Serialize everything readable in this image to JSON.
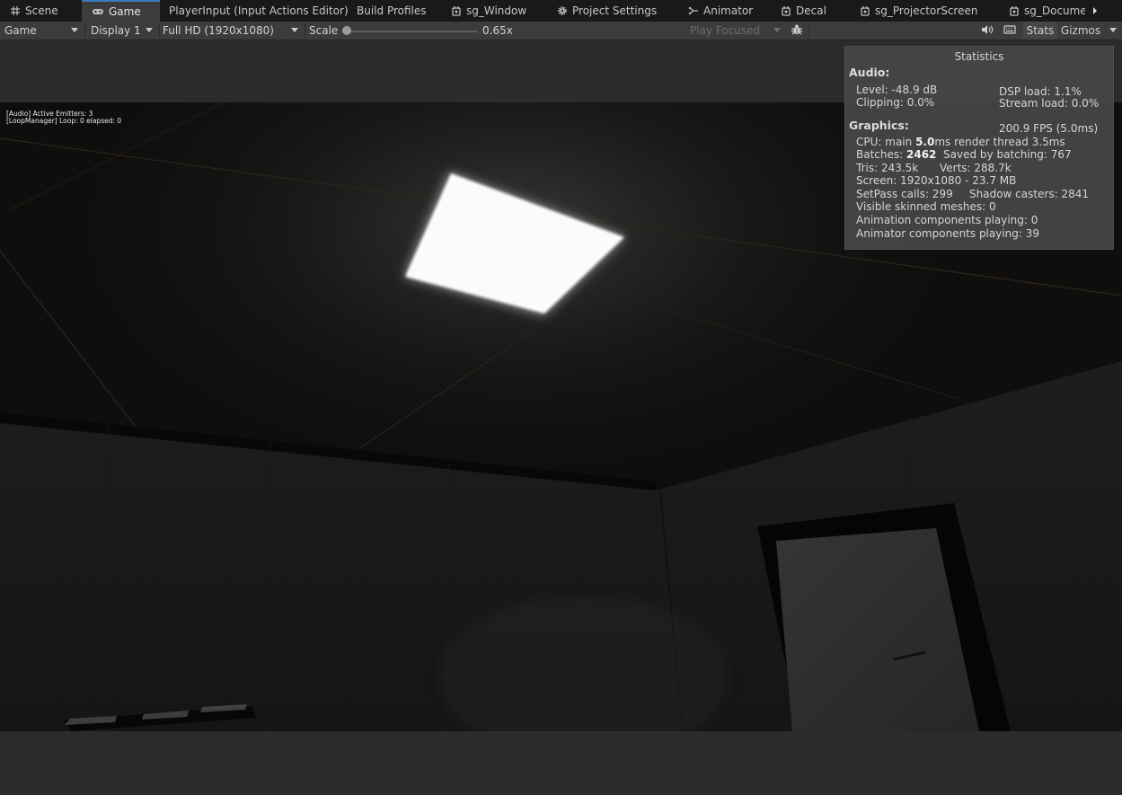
{
  "tabs": [
    {
      "label": "Scene",
      "icon": "grid-icon",
      "active": false
    },
    {
      "label": "Game",
      "icon": "gamepad-icon",
      "active": true
    },
    {
      "label": "PlayerInput (Input Actions Editor)",
      "icon": "",
      "active": false
    },
    {
      "label": "Build Profiles",
      "icon": "",
      "active": false
    },
    {
      "label": "sg_Window",
      "icon": "shadergraph-icon",
      "active": false
    },
    {
      "label": "Project Settings",
      "icon": "gear-icon",
      "active": false
    },
    {
      "label": "Animator",
      "icon": "animator-icon",
      "active": false
    },
    {
      "label": "Decal",
      "icon": "shadergraph-icon",
      "active": false
    },
    {
      "label": "sg_ProjectorScreen",
      "icon": "shadergraph-icon",
      "active": false
    },
    {
      "label": "sg_Documer",
      "icon": "shadergraph-icon",
      "active": false
    }
  ],
  "toolbar": {
    "view_mode": "Game",
    "display": "Display 1",
    "resolution": "Full HD (1920x1080)",
    "scale_label": "Scale",
    "scale_value": "0.65x",
    "play_mode": "Play Focused",
    "stats_label": "Stats",
    "gizmos_label": "Gizmos"
  },
  "game_view": {
    "debug_lines": [
      "[Audio] Active Emitters: 3",
      "[LoopManager] Loop: 0 elapsed: 0"
    ]
  },
  "stats": {
    "title": "Statistics",
    "audio_header": "Audio:",
    "level": "Level: -48.9 dB",
    "clipping": "Clipping: 0.0%",
    "dsp_load": "DSP load: 1.1%",
    "stream_load": "Stream load: 0.0%",
    "graphics_header": "Graphics:",
    "fps": "200.9 FPS (5.0ms)",
    "cpu_prefix": "CPU: main",
    "cpu_main": "5.0",
    "cpu_suffix": "ms  render thread 3.5ms",
    "batches_prefix": "Batches:",
    "batches": "2462",
    "batches_suffix": "Saved by batching: 767",
    "tris": "Tris: 243.5k",
    "verts": "Verts: 288.7k",
    "screen": "Screen: 1920x1080 - 23.7 MB",
    "setpass": "SetPass calls: 299",
    "shadow_casters": "Shadow casters: 2841",
    "skinned": "Visible skinned meshes: 0",
    "animation": "Animation components playing: 0",
    "animator": "Animator components playing: 39"
  }
}
